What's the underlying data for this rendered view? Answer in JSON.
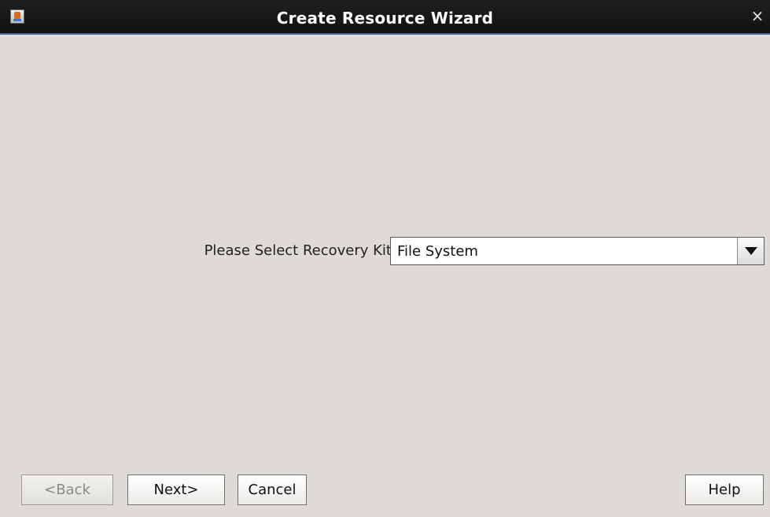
{
  "window": {
    "title": "Create Resource Wizard",
    "close_symbol": "×",
    "app_icon": "java-icon"
  },
  "form": {
    "recovery_kit_label": "Please Select Recovery Kit",
    "recovery_kit_value": "File System",
    "dropdown_icon": "chevron-down-icon"
  },
  "buttons": {
    "back": "<Back",
    "next": "Next>",
    "cancel": "Cancel",
    "help": "Help"
  }
}
